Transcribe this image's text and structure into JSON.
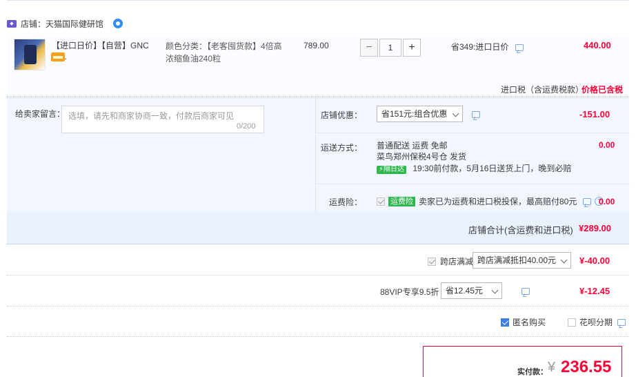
{
  "shop": {
    "label": "店铺：天猫国际健研馆",
    "icon": "tmall-shop-icon",
    "badge_icon": "wangwang-chat-icon"
  },
  "item": {
    "title": "【进口日价】【自营】GNC健...",
    "sku_label": "颜色分类：【老客囤货款】4倍高浓缩鱼油240粒",
    "price": "789.00",
    "quantity": "1",
    "save": "省349:进口日价",
    "total": "440.00",
    "tax_label": "进口税（含运费税款）",
    "tax_value": "价格已含税"
  },
  "message": {
    "label": "给卖家留言：",
    "placeholder": "选填，请先和商家协商一致，付款后商家可见",
    "count": "0/200"
  },
  "shop_discount": {
    "label": "店铺优惠：",
    "selected": "省151元:组合优惠",
    "value": "-151.00"
  },
  "shipping": {
    "label": "运送方式：",
    "line1": "普通配送 运费 免邮",
    "line2": "菜鸟郑州保税4号仓   发货",
    "badge": "隔日达",
    "line3": "19:30前付款，5月16日送货上门，晚到必赔",
    "value": "0.00"
  },
  "insurance": {
    "label": "运费险：",
    "badge": "运费险",
    "text": "卖家已为运费和进口税投保，最高赔付80元",
    "value": "0.00"
  },
  "shop_total": {
    "label": "店铺合计(含运费和进口税)",
    "value": "¥289.00"
  },
  "cross_shop": {
    "label": "跨店满减",
    "selected": "跨店满减抵扣40.00元",
    "value": "¥-40.00"
  },
  "vip": {
    "label": "88VIP专享9.5折",
    "selected": "省12.45元",
    "value": "¥-12.45"
  },
  "options": {
    "anonymous": "匿名购买",
    "huabei": "花呗分期"
  },
  "pay": {
    "label": "实付款：",
    "currency": "¥",
    "value": "236.55"
  },
  "colors": {
    "accent": "#ff0036",
    "panel": "#f2f7ff",
    "badge_green": "#2db84d"
  }
}
